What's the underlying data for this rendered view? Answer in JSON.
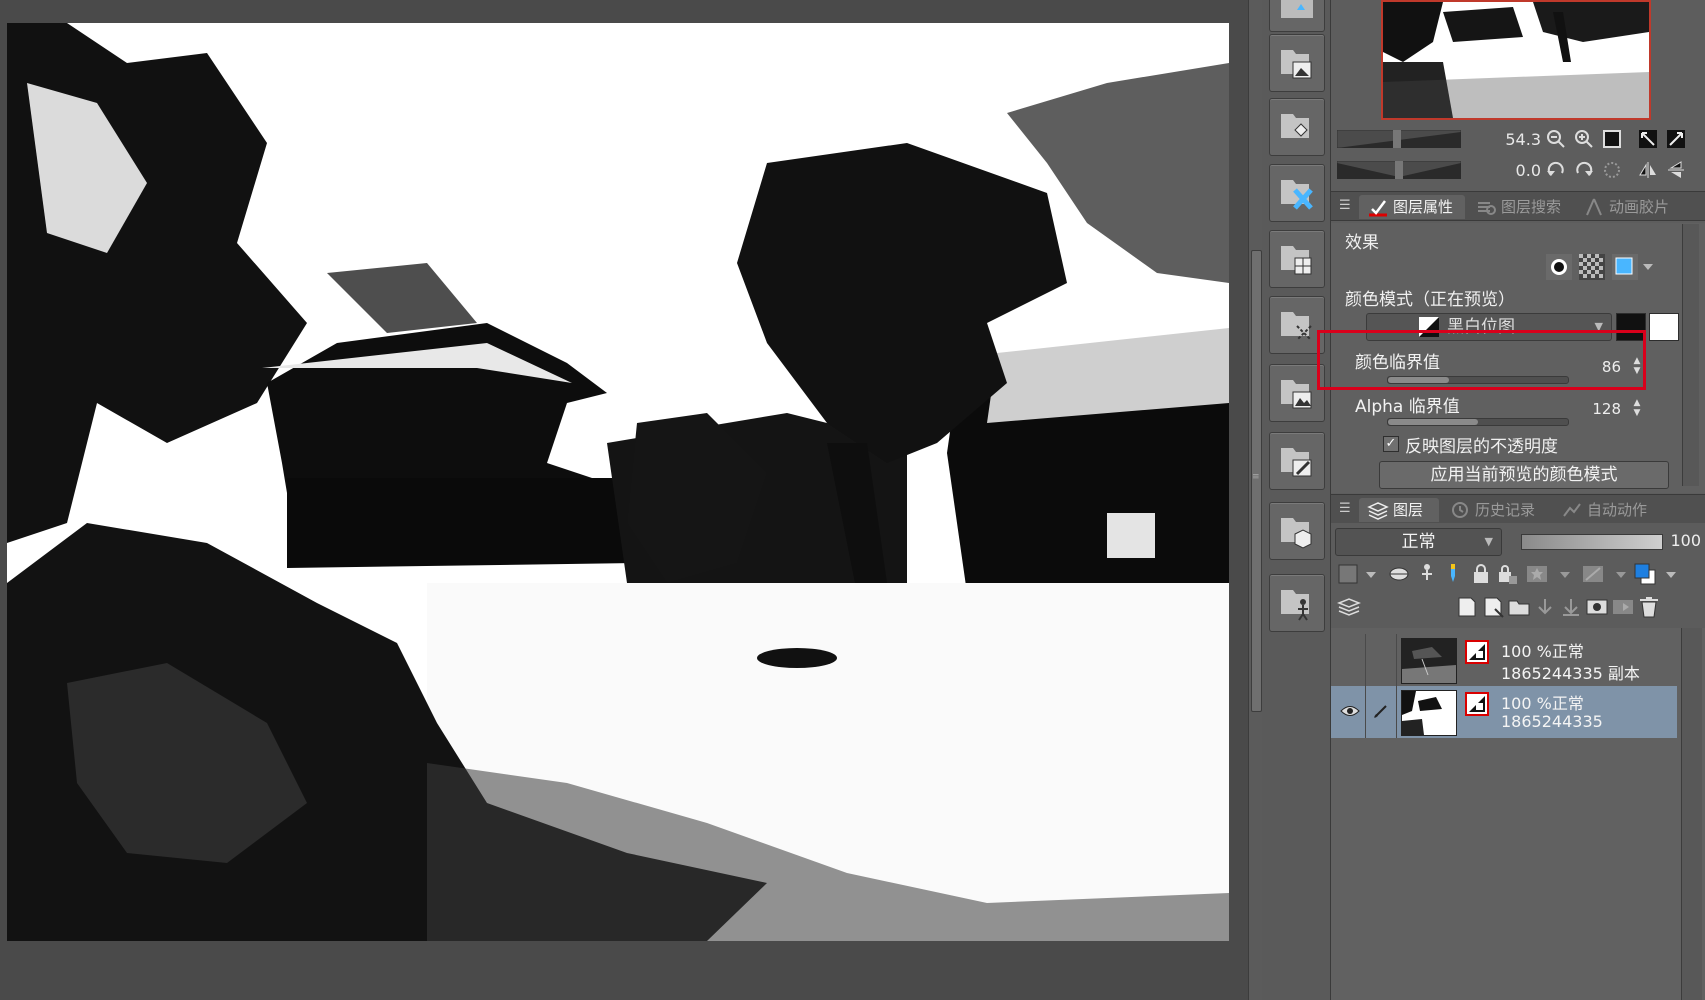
{
  "navigator": {
    "zoom_value": "54.3",
    "rotation_value": "0.0"
  },
  "property_tabs": [
    {
      "label": "图层属性",
      "active": true
    },
    {
      "label": "图层搜索",
      "active": false
    },
    {
      "label": "动画胶片",
      "active": false
    }
  ],
  "layer_properties": {
    "effect_label": "效果",
    "color_mode_label": "颜色模式（正在预览）",
    "color_mode_value": "黑白位图",
    "color_threshold_label": "颜色临界值",
    "color_threshold_value": "86",
    "color_threshold_fraction": 0.34,
    "alpha_threshold_label": "Alpha 临界值",
    "alpha_threshold_value": "128",
    "alpha_threshold_fraction": 0.5,
    "reflect_opacity_label": "反映图层的不透明度",
    "reflect_opacity_checked": true,
    "apply_button_label": "应用当前预览的颜色模式"
  },
  "layer_tabs": [
    {
      "label": "图层",
      "active": true
    },
    {
      "label": "历史记录",
      "active": false
    },
    {
      "label": "自动动作",
      "active": false
    }
  ],
  "layer_controls": {
    "blend_mode": "正常",
    "opacity": "100",
    "opacity_fraction": 1.0
  },
  "layers": [
    {
      "line1": "100 %正常",
      "line2": "1865244335 副本",
      "visible": false,
      "selected": false
    },
    {
      "line1": "100 %正常",
      "line2": "1865244335",
      "visible": true,
      "selected": true
    }
  ],
  "colors": {
    "highlight": "#d9001b",
    "selected_layer": "#7f93a8"
  }
}
